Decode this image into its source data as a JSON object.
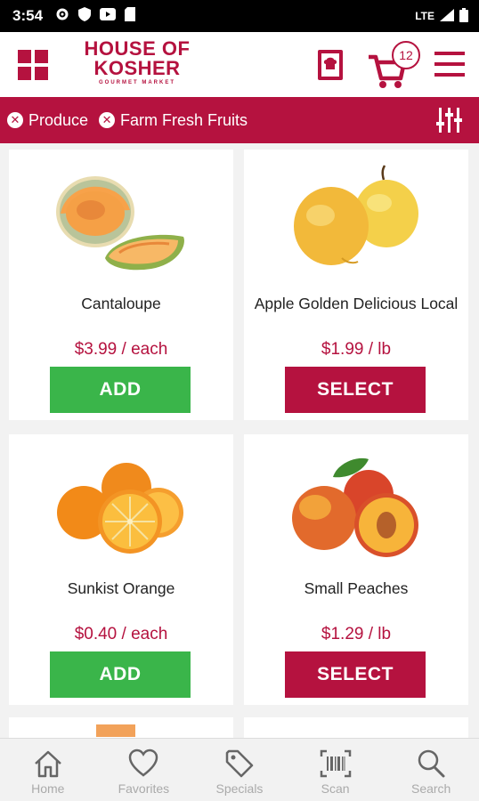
{
  "status_bar": {
    "time": "3:54",
    "network": "LTE"
  },
  "header": {
    "logo_line1": "HOUSE OF",
    "logo_line2": "KOSHER",
    "logo_tagline": "GOURMET MARKET",
    "cart_count": "12"
  },
  "filters": [
    {
      "label": "Produce"
    },
    {
      "label": "Farm Fresh Fruits"
    }
  ],
  "products": [
    {
      "name": "Cantaloupe",
      "price": "$3.99 / each",
      "button": "ADD",
      "image": "cantaloupe"
    },
    {
      "name": "Apple Golden Delicious Local",
      "price": "$1.99 / lb",
      "button": "SELECT",
      "image": "golden-apples"
    },
    {
      "name": "Sunkist Orange",
      "price": "$0.40 / each",
      "button": "ADD",
      "image": "oranges"
    },
    {
      "name": "Small Peaches",
      "price": "$1.29 / lb",
      "button": "SELECT",
      "image": "peaches"
    }
  ],
  "bottom_nav": [
    {
      "label": "Home",
      "icon": "home-icon"
    },
    {
      "label": "Favorites",
      "icon": "heart-icon"
    },
    {
      "label": "Specials",
      "icon": "tag-icon"
    },
    {
      "label": "Scan",
      "icon": "barcode-icon"
    },
    {
      "label": "Search",
      "icon": "search-icon"
    }
  ],
  "colors": {
    "brand": "#b5123f",
    "add_green": "#3ab54a"
  }
}
